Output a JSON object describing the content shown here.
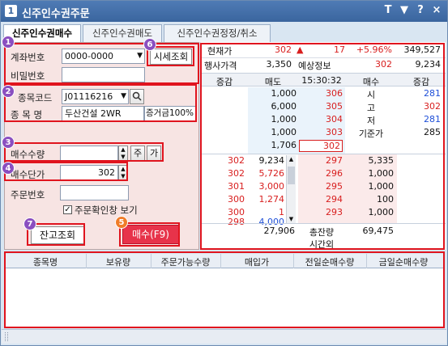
{
  "window": {
    "title_icon": "1",
    "title": "신주인수권주문",
    "controls": [
      "T",
      "▼",
      "?",
      "×"
    ]
  },
  "tabs": [
    {
      "label": "신주인수권매수",
      "active": true
    },
    {
      "label": "신주인수권매도",
      "active": false
    },
    {
      "label": "신주인수권정정/취소",
      "active": false
    }
  ],
  "form": {
    "account_label": "계좌번호",
    "account_value": "0000-0000",
    "password_label": "비밀번호",
    "password_value": "",
    "code_label": "종목코드",
    "code_value": "J01116216",
    "name_label": "종 목 명",
    "name_value": "두산건설 2WR",
    "margin_label": "증거금100%",
    "qty_label": "매수수량",
    "qty_value": "",
    "qty_btn1": "주",
    "qty_btn2": "가",
    "price_label": "매수단가",
    "price_value": "302",
    "order_no_label": "주문번호",
    "order_no_value": "",
    "confirm_label": "주문확인창 보기",
    "confirm_checked": true,
    "balance_button": "잔고조회",
    "buy_button": "매수(F9)",
    "quote_button": "시세조회"
  },
  "badges": [
    "1",
    "2",
    "3",
    "4",
    "5",
    "6",
    "7"
  ],
  "quote": {
    "current_label": "현재가",
    "current_value": "302",
    "change_arrow": "▲",
    "change_value": "17",
    "change_pct": "+5.96%",
    "volume": "349,527",
    "exercise_label": "행사가격",
    "exercise_value": "3,350",
    "expected_label": "예상정보",
    "expected_value": "302",
    "expected_volume": "9,234",
    "header": [
      "증감",
      "매도",
      "15:30:32",
      "매수",
      "증감"
    ],
    "ask_rows": [
      {
        "qty": "1,000",
        "price": "306",
        "label": "시",
        "label_value": "281"
      },
      {
        "qty": "6,000",
        "price": "305",
        "label": "고",
        "label_value": "302"
      },
      {
        "qty": "1,000",
        "price": "304",
        "label": "저",
        "label_value": "281"
      },
      {
        "qty": "1,000",
        "price": "303",
        "label": "기준가",
        "label_value": "285"
      },
      {
        "qty": "1,706",
        "price": "302",
        "label": "",
        "label_value": ""
      }
    ],
    "bid_rows": [
      {
        "chg": "302",
        "qty": "9,234",
        "price": "297",
        "bid_qty": "5,335"
      },
      {
        "chg": "302",
        "qty": "5,726",
        "price": "296",
        "bid_qty": "1,000"
      },
      {
        "chg": "301",
        "qty": "3,000",
        "price": "295",
        "bid_qty": "1,000"
      },
      {
        "chg": "300",
        "qty": "1,274",
        "price": "294",
        "bid_qty": "100"
      },
      {
        "chg": "300",
        "qty": "1",
        "price": "293",
        "bid_qty": "1,000"
      },
      {
        "chg": "298",
        "qty": "4,000",
        "price": "",
        "bid_qty": ""
      }
    ],
    "total_ask": "27,906",
    "total_label": "총잔량",
    "total_bid": "69,475",
    "after_hours_label": "시간외"
  },
  "holdings": {
    "columns": [
      "종목명",
      "보유량",
      "주문가능수량",
      "매입가",
      "전일순매수량",
      "금일순매수량"
    ]
  },
  "colors": {
    "accent_red": "#e0141e",
    "up_red": "#d81e1e",
    "down_blue": "#1e4fd8",
    "badge_purple": "#8a4fc0",
    "badge_orange": "#f07c29",
    "title_blue": "#3a659e"
  }
}
